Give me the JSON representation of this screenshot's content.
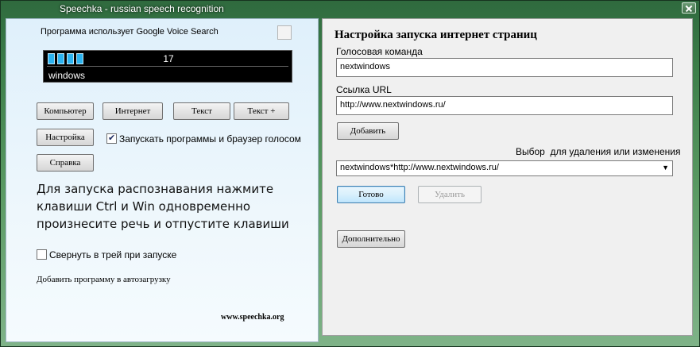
{
  "window": {
    "title": "Speechka - russian speech recognition"
  },
  "left": {
    "google_label": "Программа использует Google Voice Search",
    "meter": {
      "count": "17",
      "word": "windows"
    },
    "buttons": {
      "computer": "Компьютер",
      "internet": "Интернет",
      "text": "Текст",
      "text_plus": "Текст +",
      "settings": "Настройка",
      "help": "Справка"
    },
    "launch_voice_label": "Запускать программы и браузер голосом",
    "launch_voice_checked": true,
    "instruction": "Для запуска распознавания нажмите клавиши Ctrl и Win одновременно произнесите речь и отпустите клавиши",
    "minimize_tray_label": "Свернуть в трей при запуске",
    "minimize_tray_checked": false,
    "autostart_link": "Добавить программу в автозагрузку",
    "site_link": "www.speechka.org"
  },
  "right": {
    "heading": "Настройка запуска интернет страниц",
    "voice_command_label": "Голосовая команда",
    "voice_command_value": "nextwindows",
    "url_label": "Ссылка URL",
    "url_value": "http://www.nextwindows.ru/",
    "add_button": "Добавить",
    "select_label": "Выбор  для удаления или изменения",
    "select_value": "nextwindows*http://www.nextwindows.ru/",
    "done_button": "Готово",
    "delete_button": "Удалить",
    "more_button": "Дополнительно"
  },
  "colors": {
    "accent": "#2bb3f0",
    "window_frame": "#3d7f4a"
  },
  "icons": {
    "close": "close-icon",
    "dropdown": "chevron-down-icon",
    "check": "check-icon"
  }
}
